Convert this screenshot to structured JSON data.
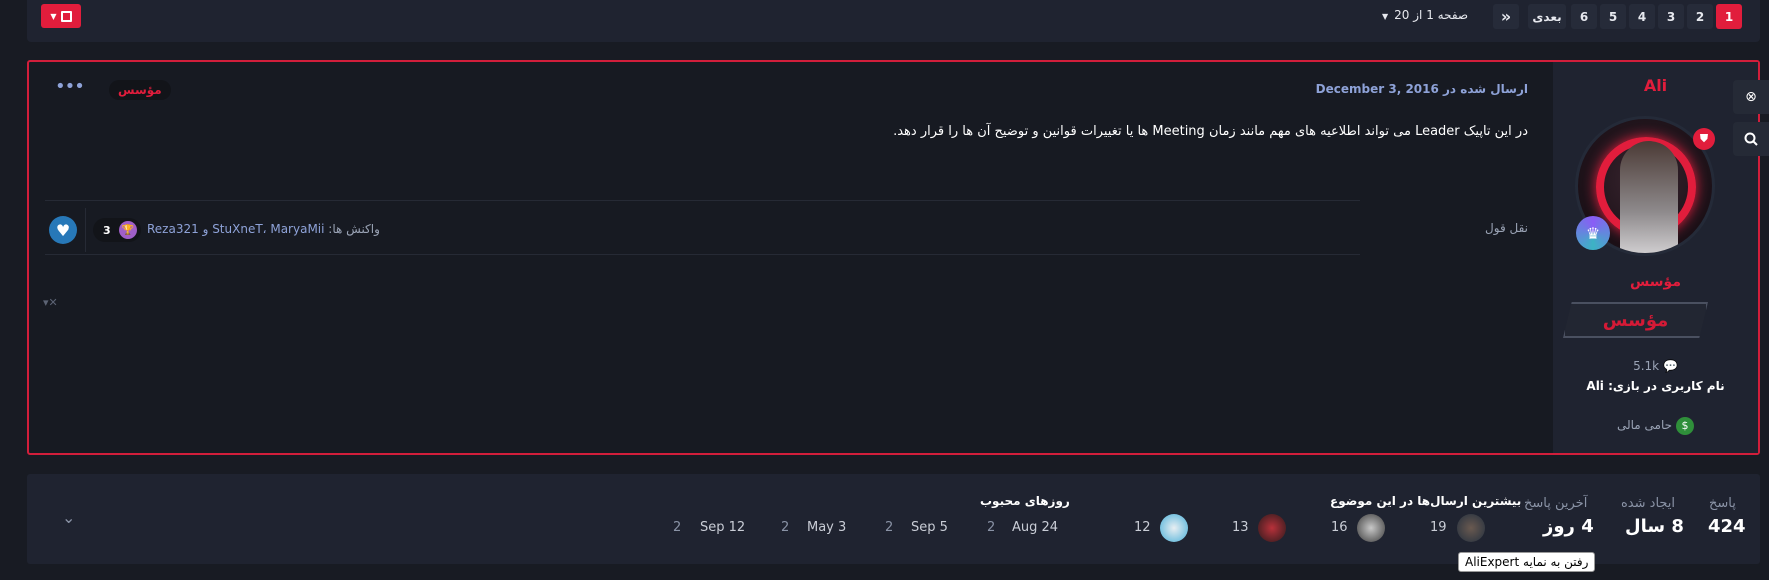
{
  "pagination": {
    "pages": [
      "1",
      "2",
      "3",
      "4",
      "5",
      "6"
    ],
    "active_page": "1",
    "next_label": "بعدی",
    "last_symbol": "»",
    "page_info": "صفحه 1 از 20"
  },
  "post": {
    "author": {
      "name": "Ali",
      "rank_title": "مؤسس",
      "rank_banner": "مؤسس",
      "post_count": "5.1k",
      "in_game_name": "نام کاربری در بازی: Ali",
      "donor_label": "حامی مالی"
    },
    "date": "ارسال شده در December 3, 2016",
    "role_badge": "مؤسس",
    "body": "در این تاپیک Leader می تواند اطلاعیه های مهم مانند زمان Meeting ها یا تغییرات قوانین و توضیح آن ها را قرار دهد.",
    "quote_label": "نقل قول",
    "reactions": {
      "count": "3",
      "label": "واکنش ها:",
      "users": "StuXneT، MaryaMii و Reza321"
    }
  },
  "topic_stats": {
    "replies": {
      "label": "پاسخ",
      "value": "424"
    },
    "created": {
      "label": "ایجاد شده",
      "value": "8 سال"
    },
    "last_reply": {
      "label": "آخرین پاسخ",
      "value": "4 روز"
    },
    "top_posters": {
      "title": "بیشترین ارسال‌ها در این موضوع",
      "counts": [
        "19",
        "16",
        "13",
        "12"
      ]
    },
    "popular_days": {
      "title": "روزهای محبوب",
      "days": [
        {
          "date": "Aug 24",
          "count": "2"
        },
        {
          "date": "Sep 5",
          "count": "2"
        },
        {
          "date": "May 3",
          "count": "2"
        },
        {
          "date": "Sep 12",
          "count": "2"
        }
      ]
    }
  },
  "tooltip": "رفتن به نمایه AliExpert",
  "colors": {
    "accent": "#e11d3c",
    "link": "#8ea2d8",
    "panel": "#1f2330"
  }
}
